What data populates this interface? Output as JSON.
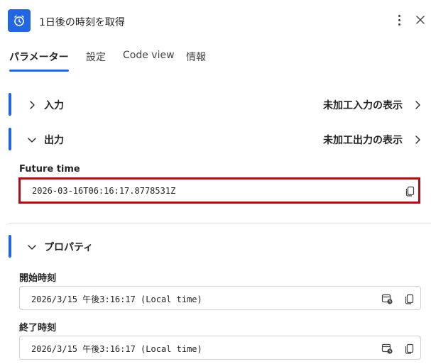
{
  "header": {
    "title": "1日後の時刻を取得",
    "app_icon": "alarm-clock-icon",
    "more_icon": "more-vertical-icon",
    "close_icon": "close-icon",
    "accent_color": "#2266e3"
  },
  "tabs": [
    {
      "label": "パラメーター",
      "active": true
    },
    {
      "label": "設定",
      "active": false
    },
    {
      "label": "Code view",
      "active": false
    },
    {
      "label": "情報",
      "active": false
    }
  ],
  "sections": {
    "input": {
      "label": "入力",
      "raw_label": "未加工入力の表示",
      "expanded": false
    },
    "output": {
      "label": "出力",
      "raw_label": "未加工出力の表示",
      "expanded": true
    },
    "properties": {
      "label": "プロパティ",
      "expanded": true
    }
  },
  "output_fields": {
    "future_time": {
      "label": "Future time",
      "value": "2026-03-16T06:16:17.8778531Z",
      "highlight_color": "#a4131c"
    }
  },
  "property_fields": {
    "start_time": {
      "label": "開始時刻",
      "value": "2026/3/15 午後3:16:17 (Local time)"
    },
    "end_time": {
      "label": "終了時刻",
      "value": "2026/3/15 午後3:16:17 (Local time)"
    }
  }
}
